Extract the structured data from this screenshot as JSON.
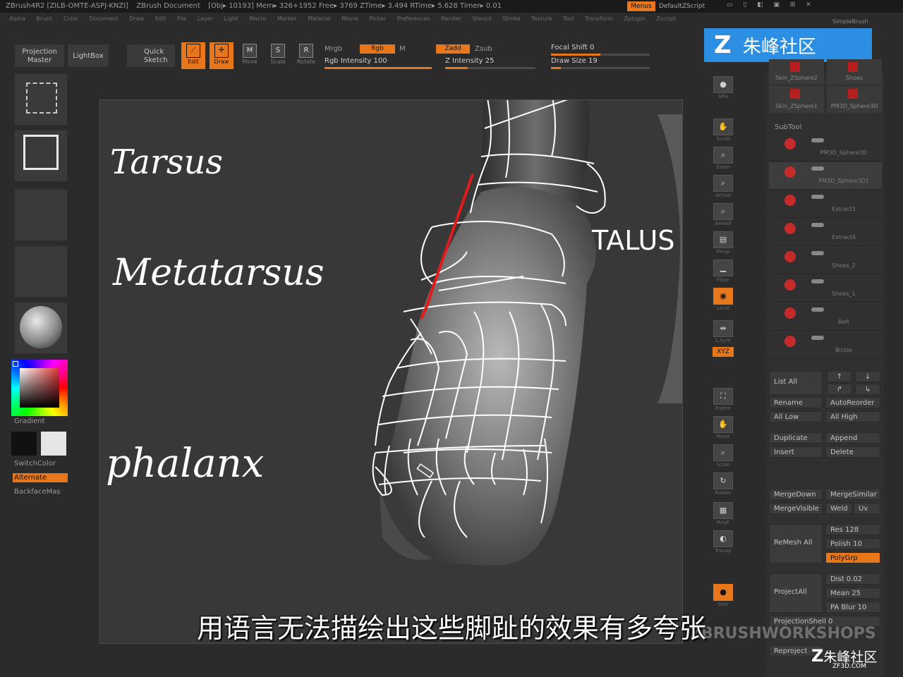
{
  "titlebar": {
    "items": [
      "ZBrush4R2 [ZILB-OMTE-ASPJ-KNZI]",
      "ZBrush Document",
      "[Obj▸ 10193] Mem▸ 326+1952 Free▸ 3769 ZTime▸ 3.494 RTime▸ 5.628 Timer▸ 0.01"
    ],
    "menus_label": "Menus",
    "default_zscript": "DefaultZScript"
  },
  "menubar": [
    "Alpha",
    "Brush",
    "Color",
    "Document",
    "Draw",
    "Edit",
    "File",
    "Layer",
    "Light",
    "Macro",
    "Marker",
    "Material",
    "Movie",
    "Picker",
    "Preferences",
    "Render",
    "Stencil",
    "Stroke",
    "Texture",
    "Tool",
    "Transform",
    "Zplugin",
    "Zscript"
  ],
  "toolbar": {
    "projection_master": "Projection\nMaster",
    "lightbox": "LightBox",
    "quick_sketch": "Quick\nSketch",
    "edit": "Edit",
    "draw": "Draw",
    "move": "Move",
    "scale": "Scale",
    "rotate": "Rotate",
    "mrgb": "Mrgb",
    "rgb": "Rgb",
    "m": "M",
    "rgb_intensity": "Rgb Intensity 100",
    "zadd": "Zadd",
    "zsub": "Zsub",
    "z_intensity": "Z Intensity 25",
    "focal_shift": "Focal Shift 0",
    "draw_size": "Draw Size 19",
    "z_intensity_value": 0.25,
    "rgb_intensity_value": 1.0,
    "focal_shift_value": 0.5,
    "draw_size_value": 0.1
  },
  "logo_label": "朱峰社区",
  "left_panel": {
    "gradient": "Gradient",
    "switch_color": "SwitchColor",
    "alternate": "Alternate",
    "backface": "BackfaceMas"
  },
  "canvas": {
    "labels": {
      "tarsus": "Tarsus",
      "metatarsus": "Metatarsus",
      "phalanx": "phalanx",
      "talus": "TALUS"
    }
  },
  "right_strip": {
    "items": [
      "SPix",
      "Scroll",
      "Zoom",
      "Actual",
      "AAHalf",
      "Persp",
      "Floor",
      "Local",
      "L.Sym",
      "XYZ",
      "Frame",
      "Move",
      "Scale",
      "Rotate",
      "PolyF",
      "Transp",
      "Solo"
    ]
  },
  "right_panel": {
    "tool_thumbs": [
      "SimpleBrush",
      "Skin_ZSphere2",
      "Shoes",
      "Skin_ZSphere1",
      "PM3D_Sphere3D"
    ],
    "subtool_header": "SubTool",
    "subtools": [
      "PM3D_Sphere3D",
      "PM3D_Sphere3D1",
      "Extract3",
      "Extract4",
      "Shoes_2",
      "Shoes_1",
      "Belt",
      "Bickle"
    ],
    "buttons": {
      "list_all": "List All",
      "rename": "Rename",
      "autoreorder": "AutoReorder",
      "all_low": "All Low",
      "all_high": "All High",
      "duplicate": "Duplicate",
      "append": "Append",
      "insert": "Insert",
      "delete": "Delete",
      "merge_down": "MergeDown",
      "merge_similar": "MergeSimilar",
      "merge_visible": "MergeVisible",
      "weld": "Weld",
      "uv": "Uv",
      "remesh_all": "ReMesh All",
      "res": "Res 128",
      "polish": "Polish 10",
      "polygrp": "PolyGrp",
      "project_all": "ProjectAll",
      "dist": "Dist 0.02",
      "mean": "Mean 25",
      "pa_blur": "PA Blur 10",
      "projection_shell": "ProjectionShell 0",
      "reproject": "Reproject"
    }
  },
  "caption": "用语言无法描绘出这些脚趾的效果有多夸张",
  "watermark": "ZBRUSHWORKSHOPS",
  "corner_logo": "朱峰社区",
  "corner_url": "ZF3D.COM",
  "accent": "#e8771c"
}
